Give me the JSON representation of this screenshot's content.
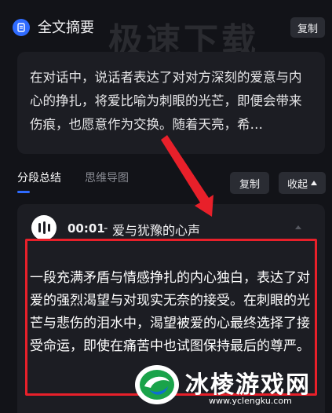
{
  "header": {
    "title": "全文摘要",
    "copy_label": "复制",
    "watermark": "极速下载"
  },
  "summary": {
    "text": "在对话中，说话者表达了对对方深刻的爱意与内心的挣扎，将爱比喻为刺眼的光芒，即便会带来伤痕，也愿意作为交换。随着天亮，希…"
  },
  "tabs": [
    {
      "label": "分段总结",
      "active": true
    },
    {
      "label": "思维导图",
      "active": false
    }
  ],
  "toolbar": {
    "copy_label": "复制",
    "collapse_label": "收起"
  },
  "segment": {
    "time": "00:01",
    "dash": "-",
    "title": "爱与犹豫的心声",
    "text": "一段充满矛盾与情感挣扎的内心独白，表达了对爱的强烈渴望与对现实无奈的接受。在刺眼的光芒与悲伤的泪水中，渴望被爱的心最终选择了接受命运，即使在痛苦中也试图保持最后的尊严。"
  },
  "site_logo": {
    "name": "冰棱游戏网",
    "url": "www.yclengku.com"
  },
  "colors": {
    "accent": "#2f6bff",
    "highlight": "#e8202a",
    "background": "#121318",
    "card": "#1c1d23"
  }
}
